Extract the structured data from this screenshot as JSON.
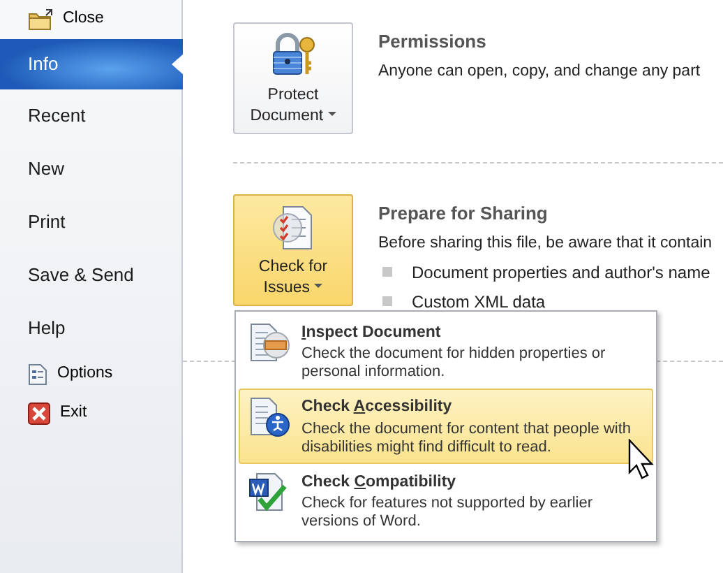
{
  "sidebar": {
    "items": [
      {
        "kind": "close",
        "label": "Close"
      },
      {
        "kind": "tab",
        "label": "Info",
        "selected": true
      },
      {
        "kind": "tab",
        "label": "Recent",
        "selected": false
      },
      {
        "kind": "tab",
        "label": "New",
        "selected": false
      },
      {
        "kind": "tab",
        "label": "Print",
        "selected": false
      },
      {
        "kind": "tab",
        "label": "Save & Send",
        "selected": false
      },
      {
        "kind": "tab",
        "label": "Help",
        "selected": false
      },
      {
        "kind": "options",
        "label": "Options"
      },
      {
        "kind": "exit",
        "label": "Exit"
      }
    ]
  },
  "sections": [
    {
      "button": {
        "label": [
          "Protect",
          "Document"
        ],
        "selected": false
      },
      "title": "Permissions",
      "description": "Anyone can open, copy, and change any part"
    },
    {
      "button": {
        "label": [
          "Check for",
          "Issues"
        ],
        "selected": true
      },
      "title": "Prepare for Sharing",
      "description": "Before sharing this file, be aware that it contain",
      "bullets": [
        "Document properties and author's name",
        "Custom XML data"
      ]
    }
  ],
  "menu": {
    "items": [
      {
        "hotkey": "I",
        "title_after": "nspect Document",
        "description": "Check the document for hidden properties or personal information.",
        "selected": false
      },
      {
        "title_before": "Check ",
        "hotkey": "A",
        "title_after": "ccessibility",
        "description": "Check the document for content that people with disabilities might find difficult to read.",
        "selected": true
      },
      {
        "title_before": "Check ",
        "hotkey": "C",
        "title_after": "ompatibility",
        "description": "Check for features not supported by earlier versions of Word.",
        "selected": false
      }
    ]
  }
}
